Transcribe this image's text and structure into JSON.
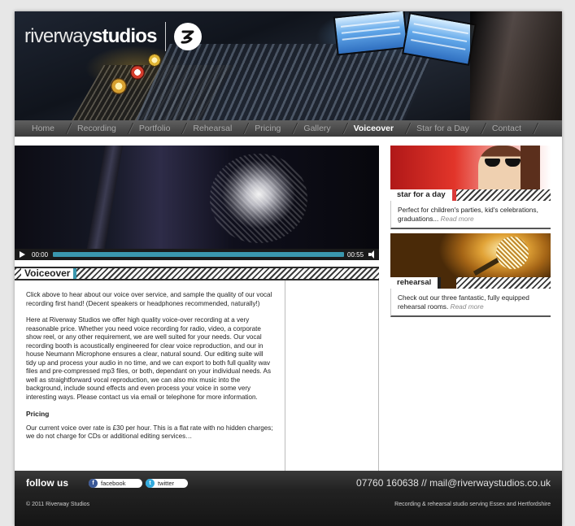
{
  "site": {
    "logo_light": "riverway",
    "logo_bold": "studios"
  },
  "nav": {
    "items": [
      {
        "label": "Home"
      },
      {
        "label": "Recording"
      },
      {
        "label": "Portfolio"
      },
      {
        "label": "Rehearsal"
      },
      {
        "label": "Pricing"
      },
      {
        "label": "Gallery"
      },
      {
        "label": "Voiceover",
        "active": true
      },
      {
        "label": "Star for a Day"
      },
      {
        "label": "Contact"
      }
    ]
  },
  "player": {
    "current_time": "00:00",
    "duration": "00:55",
    "progress": 0
  },
  "main": {
    "section_title": "Voiceover",
    "intro": "Click above to hear about our voice over service, and sample the quality of our vocal recording first hand! (Decent speakers or headphones recommended, naturally!)",
    "body": "Here at Riverway Studios we offer high quality voice-over recording at a very reasonable price. Whether you need voice recording for radio, video, a corporate show reel, or any other requirement, we are well suited for your needs. Our vocal recording booth is acoustically engineered for clear voice reproduction, and our in house Neumann Microphone ensures a clear, natural sound. Our editing suite will tidy up and process your audio in no time, and we can export to both full quality wav files and pre-compressed mp3 files, or both, dependant on your individual needs. As well as straightforward vocal reproduction, we can also mix music into the background, include sound effects and even process your voice in some very interesting ways. Please contact us via email or telephone for more information.",
    "pricing_heading": "Pricing",
    "pricing_text": "Our current voice over rate is £30 per hour. This is a flat rate with no hidden charges; we do not charge for CDs or additional editing services…"
  },
  "sidebar": {
    "cards": [
      {
        "label": "star for a day",
        "text": "Perfect for children's parties, kid's celebrations, graduations...",
        "read_more": "Read more"
      },
      {
        "label": "rehearsal",
        "text": "Check out our three fantastic, fully equipped rehearsal rooms.",
        "read_more": "Read more"
      }
    ]
  },
  "footer": {
    "follow_label": "follow us",
    "facebook": "facebook",
    "twitter": "twitter",
    "contact": "07760 160638 // mail@riverwaystudios.co.uk",
    "copyright": "© 2011 Riverway Studios",
    "tagline": "Recording & rehearsal studio serving Essex and Hertfordshire"
  },
  "colors": {
    "accent_teal": "#3a97ae",
    "accent_red": "#d93a3a",
    "nav_bg": "#3b3b3b",
    "footer_bg": "#222222"
  }
}
